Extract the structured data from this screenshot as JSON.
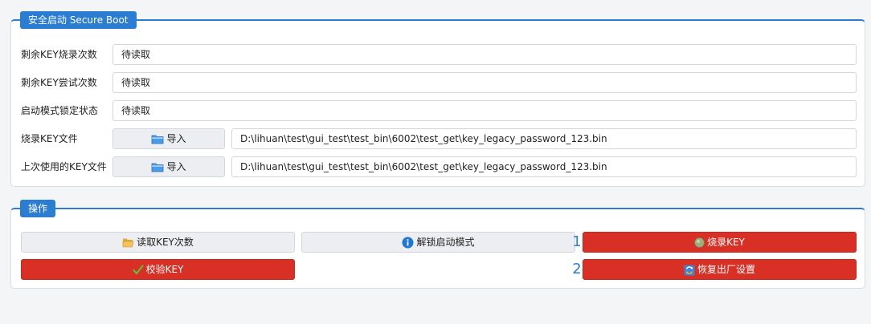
{
  "secure_boot": {
    "title": "安全启动 Secure Boot",
    "rows": [
      {
        "label": "剩余KEY烧录次数",
        "value": "待读取"
      },
      {
        "label": "剩余KEY尝试次数",
        "value": "待读取"
      },
      {
        "label": "启动模式锁定状态",
        "value": "待读取"
      }
    ],
    "burn_key_file": {
      "label": "烧录KEY文件",
      "button": "导入",
      "path": "D:\\lihuan\\test\\gui_test\\test_bin\\6002\\test_get\\key_legacy_password_123.bin"
    },
    "last_key_file": {
      "label": "上次使用的KEY文件",
      "button": "导入",
      "path": "D:\\lihuan\\test\\gui_test\\test_bin\\6002\\test_get\\key_legacy_password_123.bin"
    }
  },
  "operations": {
    "title": "操作",
    "read_key_count": "读取KEY次数",
    "unlock_boot_mode": "解锁启动模式",
    "burn_key": "烧录KEY",
    "verify_key": "校验KEY",
    "factory_reset": "恢复出厂设置",
    "step_1": "1",
    "step_2": "2"
  },
  "colors": {
    "accent": "#2b7cd3",
    "danger": "#d93025"
  },
  "icons": {
    "import": "folder-icon",
    "read": "folder-open-icon",
    "unlock": "info-icon",
    "burn": "disc-icon",
    "verify": "checkmark-icon",
    "reset": "refresh-icon"
  }
}
